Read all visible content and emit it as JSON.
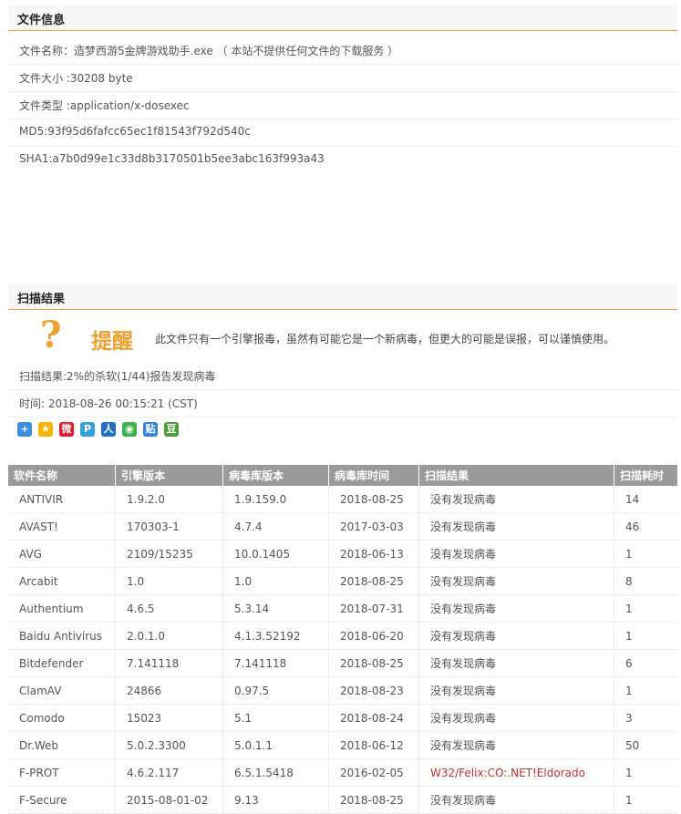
{
  "file_info": {
    "header": "文件信息",
    "name_line": "文件名称：造梦西游5金牌游戏助手.exe （ 本站不提供任何文件的下载服务 ）",
    "size_line": "文件大小 :30208 byte",
    "type_line": "文件类型 :application/x-dosexec",
    "md5_line": "MD5:93f95d6fafcc65ec1f81543f792d540c",
    "sha1_line": "SHA1:a7b0d99e1c33d8b3170501b5ee3abc163f993a43"
  },
  "scan": {
    "header": "扫描结果",
    "icon": "question-mark-icon",
    "alert_title": "提醒",
    "alert_message": "此文件只有一个引擎报毒，虽然有可能它是一个新病毒，但更大的可能是误报，可以谨慎使用。",
    "result_line": "扫描结果:2%的杀软(1/44)报告发现病毒",
    "time_line": "时间: 2018-08-26 00:15:21 (CST)",
    "share_icons": [
      "share-more-icon",
      "qzone-icon",
      "weibo-icon",
      "tencent-weibo-icon",
      "renren-icon",
      "wechat-icon",
      "tieba-icon",
      "douban-icon"
    ]
  },
  "colors": {
    "accent": "#f0a030",
    "table_header": "#9a9a9a",
    "warn_text": "#c03030"
  },
  "table": {
    "headers": [
      "软件名称",
      "引擎版本",
      "病毒库版本",
      "病毒库时间",
      "扫描结果",
      "扫描耗时"
    ],
    "rows": [
      [
        "ANTIVIR",
        "1.9.2.0",
        "1.9.159.0",
        "2018-08-25",
        "没有发现病毒",
        "14"
      ],
      [
        "AVAST!",
        "170303-1",
        "4.7.4",
        "2017-03-03",
        "没有发现病毒",
        "46"
      ],
      [
        "AVG",
        "2109/15235",
        "10.0.1405",
        "2018-06-13",
        "没有发现病毒",
        "1"
      ],
      [
        "Arcabit",
        "1.0",
        "1.0",
        "2018-08-25",
        "没有发现病毒",
        "8"
      ],
      [
        "Authentium",
        "4.6.5",
        "5.3.14",
        "2018-07-31",
        "没有发现病毒",
        "1"
      ],
      [
        "Baidu Antivirus",
        "2.0.1.0",
        "4.1.3.52192",
        "2018-06-20",
        "没有发现病毒",
        "1"
      ],
      [
        "Bitdefender",
        "7.141118",
        "7.141118",
        "2018-08-25",
        "没有发现病毒",
        "6"
      ],
      [
        "ClamAV",
        "24866",
        "0.97.5",
        "2018-08-23",
        "没有发现病毒",
        "1"
      ],
      [
        "Comodo",
        "15023",
        "5.1",
        "2018-08-24",
        "没有发现病毒",
        "3"
      ],
      [
        "Dr.Web",
        "5.0.2.3300",
        "5.0.1.1",
        "2018-06-12",
        "没有发现病毒",
        "50"
      ],
      [
        "F-PROT",
        "4.6.2.117",
        "6.5.1.5418",
        "2016-02-05",
        "W32/Felix:CO:.NET!Eldorado",
        "1"
      ],
      [
        "F-Secure",
        "2015-08-01-02",
        "9.13",
        "2018-08-25",
        "没有发现病毒",
        "1"
      ]
    ]
  }
}
